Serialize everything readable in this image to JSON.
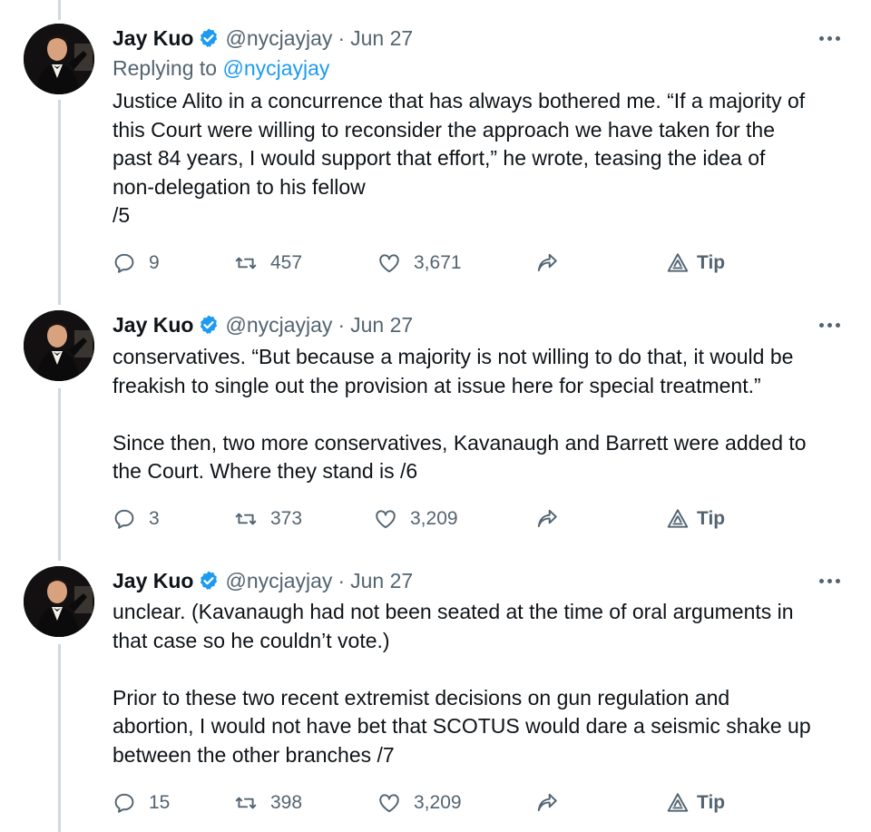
{
  "tweets": [
    {
      "name": "Jay Kuo",
      "handle": "@nycjayjay",
      "separator": "·",
      "date": "Jun 27",
      "replying_prefix": "Replying to ",
      "replying_to": "@nycjayjay",
      "text": "Justice Alito in a concurrence that has always bothered me. “If a majority of\nthis Court were willing to reconsider the approach we have taken for the\npast 84 years, I would support that effort,” he wrote, teasing the idea of\nnon-delegation to his fellow\n/5",
      "replies": "9",
      "retweets": "457",
      "likes": "3,671",
      "tip_label": "Tip"
    },
    {
      "name": "Jay Kuo",
      "handle": "@nycjayjay",
      "separator": "·",
      "date": "Jun 27",
      "text": "conservatives. “But because a majority is not willing to do that, it would be\nfreakish to single out the provision at issue here for special treatment.”\n\nSince then, two more conservatives, Kavanaugh and Barrett were added to\nthe Court. Where they stand is /6",
      "replies": "3",
      "retweets": "373",
      "likes": "3,209",
      "tip_label": "Tip"
    },
    {
      "name": "Jay Kuo",
      "handle": "@nycjayjay",
      "separator": "·",
      "date": "Jun 27",
      "text": "unclear. (Kavanaugh had not been seated at the time of oral arguments in\nthat case so he couldn’t vote.)\n\nPrior to these two recent extremist decisions on gun regulation and\nabortion, I would not have bet that SCOTUS would dare a seismic shake up\nbetween the other branches /7",
      "replies": "15",
      "retweets": "398",
      "likes": "3,209",
      "tip_label": "Tip"
    }
  ],
  "colors": {
    "text": "#0f1419",
    "secondary": "#536471",
    "link": "#1d9bf0",
    "thread_line": "#cfd9de",
    "verified": "#1d9bf0"
  },
  "icons": {
    "verified": "verified-badge-icon",
    "reply": "reply-icon",
    "retweet": "retweet-icon",
    "like": "heart-icon",
    "share": "share-icon",
    "tip": "tip-icon",
    "more": "more-icon"
  }
}
